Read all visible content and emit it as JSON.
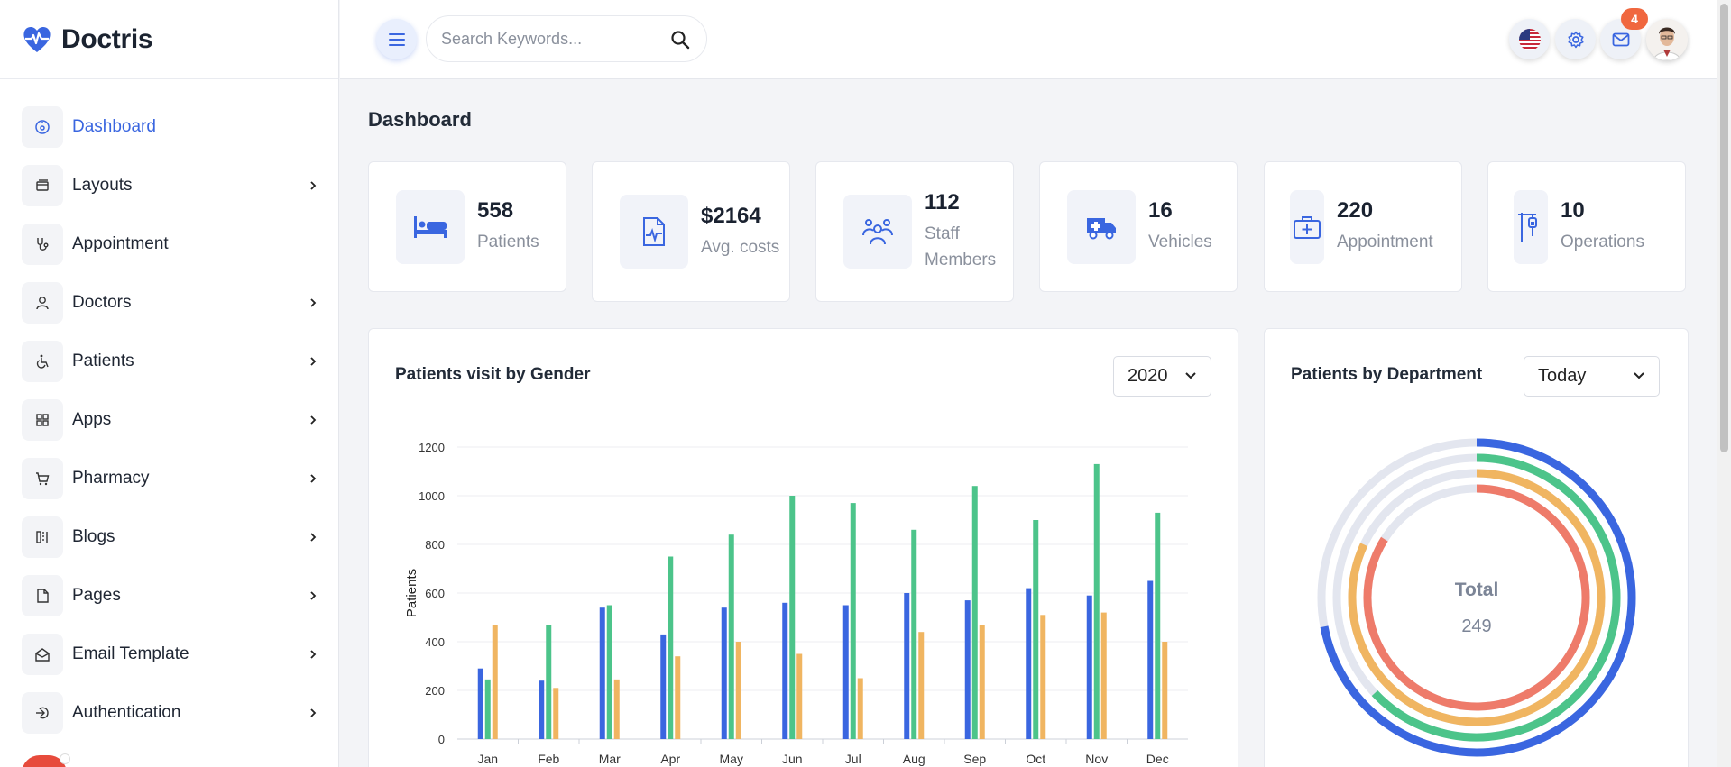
{
  "brand": {
    "name": "Doctris"
  },
  "sidebar": {
    "items": [
      {
        "label": "Dashboard",
        "icon": "dashboard-icon",
        "active": true,
        "has_children": false
      },
      {
        "label": "Layouts",
        "icon": "layouts-icon",
        "has_children": true
      },
      {
        "label": "Appointment",
        "icon": "stethoscope-icon",
        "has_children": false
      },
      {
        "label": "Doctors",
        "icon": "user-icon",
        "has_children": true
      },
      {
        "label": "Patients",
        "icon": "wheelchair-icon",
        "has_children": true
      },
      {
        "label": "Apps",
        "icon": "apps-grid-icon",
        "has_children": true
      },
      {
        "label": "Pharmacy",
        "icon": "cart-icon",
        "has_children": true
      },
      {
        "label": "Blogs",
        "icon": "blog-icon",
        "has_children": true
      },
      {
        "label": "Pages",
        "icon": "page-icon",
        "has_children": true
      },
      {
        "label": "Email Template",
        "icon": "envelope-open-icon",
        "has_children": true
      },
      {
        "label": "Authentication",
        "icon": "login-icon",
        "has_children": true
      }
    ]
  },
  "topbar": {
    "search_placeholder": "Search Keywords...",
    "notification_count": "4"
  },
  "page": {
    "title": "Dashboard"
  },
  "stats": [
    {
      "value": "558",
      "label": "Patients"
    },
    {
      "value": "$2164",
      "label": "Avg. costs"
    },
    {
      "value": "112",
      "label": "Staff Members"
    },
    {
      "value": "16",
      "label": "Vehicles"
    },
    {
      "value": "220",
      "label": "Appointment"
    },
    {
      "value": "10",
      "label": "Operations"
    }
  ],
  "gender_panel": {
    "title": "Patients visit by Gender",
    "selected_year": "2020"
  },
  "department_panel": {
    "title": "Patients by Department",
    "selected_range": "Today"
  },
  "colors": {
    "accent": "#3a66e0",
    "green": "#4cc48a",
    "orange": "#f0b561",
    "red": "#ee7b6a",
    "track": "#e3e6ef"
  },
  "chart_data": [
    {
      "type": "bar",
      "title": "Patients visit by Gender",
      "ylabel": "Patients",
      "xlabel": "",
      "ylim": [
        0,
        1200
      ],
      "yticks": [
        "0",
        "200",
        "400",
        "600",
        "800",
        "1000",
        "1200"
      ],
      "categories": [
        "Jan",
        "Feb",
        "Mar",
        "Apr",
        "May",
        "Jun",
        "Jul",
        "Aug",
        "Sep",
        "Oct",
        "Nov",
        "Dec"
      ],
      "series": [
        {
          "color": "#3a66e0",
          "values": [
            290,
            240,
            540,
            430,
            540,
            560,
            550,
            600,
            570,
            620,
            590,
            650
          ]
        },
        {
          "color": "#4cc48a",
          "values": [
            245,
            470,
            550,
            750,
            840,
            1000,
            970,
            860,
            1040,
            900,
            1130,
            930
          ]
        },
        {
          "color": "#f0b561",
          "values": [
            470,
            210,
            245,
            340,
            400,
            350,
            250,
            440,
            470,
            510,
            520,
            400
          ]
        }
      ],
      "grid": true,
      "legend": "none"
    },
    {
      "type": "radialBar",
      "title": "Patients by Department",
      "center_label": "Total",
      "center_value": "249",
      "series": [
        {
          "color": "#3a66e0",
          "percent": 72
        },
        {
          "color": "#4cc48a",
          "percent": 63
        },
        {
          "color": "#f0b561",
          "percent": 82
        },
        {
          "color": "#ee7b6a",
          "percent": 84
        }
      ]
    }
  ]
}
